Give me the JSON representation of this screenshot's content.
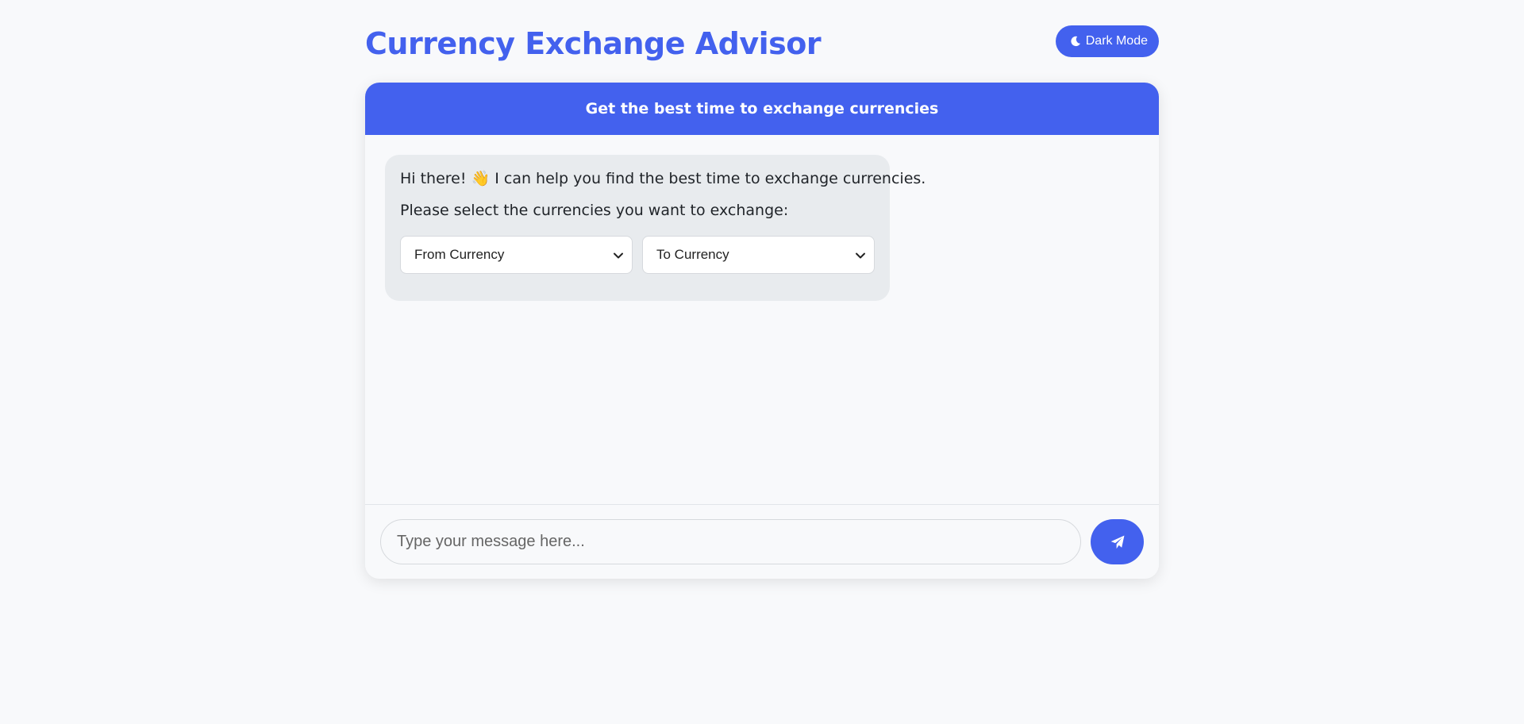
{
  "header": {
    "title": "Currency Exchange Advisor",
    "dark_mode_label": "Dark Mode",
    "dark_mode_icon": "moon-icon"
  },
  "chat": {
    "header_text": "Get the best time to exchange currencies",
    "messages": [
      {
        "sender": "bot",
        "lines": [
          "Hi there! 👋 I can help you find the best time to exchange currencies.",
          "Please select the currencies you want to exchange:"
        ],
        "selects": [
          {
            "selected": "From Currency"
          },
          {
            "selected": "To Currency"
          }
        ]
      }
    ],
    "input_placeholder": "Type your message here...",
    "input_value": "",
    "send_icon": "paper-plane-icon"
  },
  "colors": {
    "accent": "#4361ee",
    "background": "#f8f9fb",
    "bot_bubble": "#e8ebee"
  }
}
